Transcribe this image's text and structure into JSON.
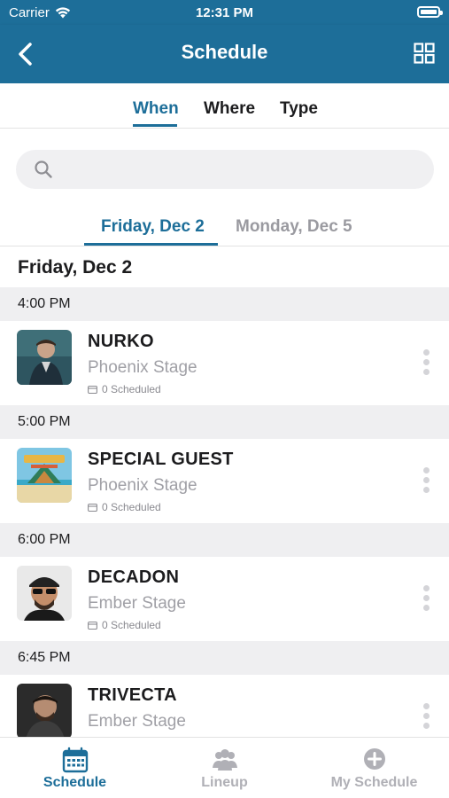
{
  "status_bar": {
    "carrier": "Carrier",
    "time": "12:31 PM"
  },
  "nav": {
    "title": "Schedule"
  },
  "filter_tabs": [
    "When",
    "Where",
    "Type"
  ],
  "search": {
    "placeholder": ""
  },
  "day_tabs": [
    "Friday, Dec 2",
    "Monday, Dec 5"
  ],
  "day_header": "Friday, Dec 2",
  "time_slots": [
    "4:00 PM",
    "5:00 PM",
    "6:00 PM",
    "6:45 PM"
  ],
  "events": [
    {
      "name": "NURKO",
      "stage": "Phoenix Stage",
      "scheduled": "0 Scheduled"
    },
    {
      "name": "SPECIAL GUEST",
      "stage": "Phoenix Stage",
      "scheduled": "0 Scheduled"
    },
    {
      "name": "DECADON",
      "stage": "Ember Stage",
      "scheduled": "0 Scheduled"
    },
    {
      "name": "TRIVECTA",
      "stage": "Ember Stage",
      "scheduled": ""
    }
  ],
  "tab_bar": [
    "Schedule",
    "Lineup",
    "My Schedule"
  ],
  "colors": {
    "brand": "#1d6e99",
    "inactive": "#b0b0b6",
    "section_bg": "#efeff1"
  }
}
